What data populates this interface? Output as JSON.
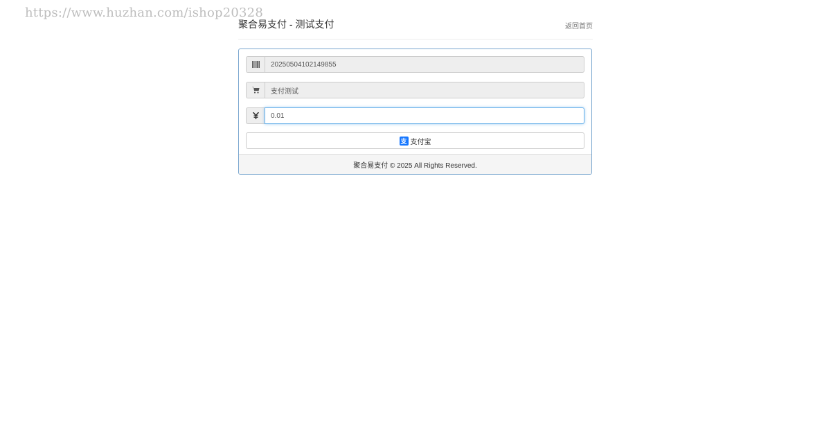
{
  "watermark": "https://www.huzhan.com/ishop20328",
  "header": {
    "title": "聚合易支付 - 测试支付",
    "home_link": "返回首页"
  },
  "form": {
    "order_no": "20250504102149855",
    "product_name": "支付测试",
    "amount": "0.01",
    "pay_button": {
      "icon_glyph": "支",
      "label": "支付宝"
    }
  },
  "footer": {
    "text": "聚合易支付 © 2025 All Rights Reserved."
  },
  "colors": {
    "panel_border": "#7aa7cf",
    "focus_border": "#66afe9",
    "alipay_blue": "#1677ff"
  }
}
